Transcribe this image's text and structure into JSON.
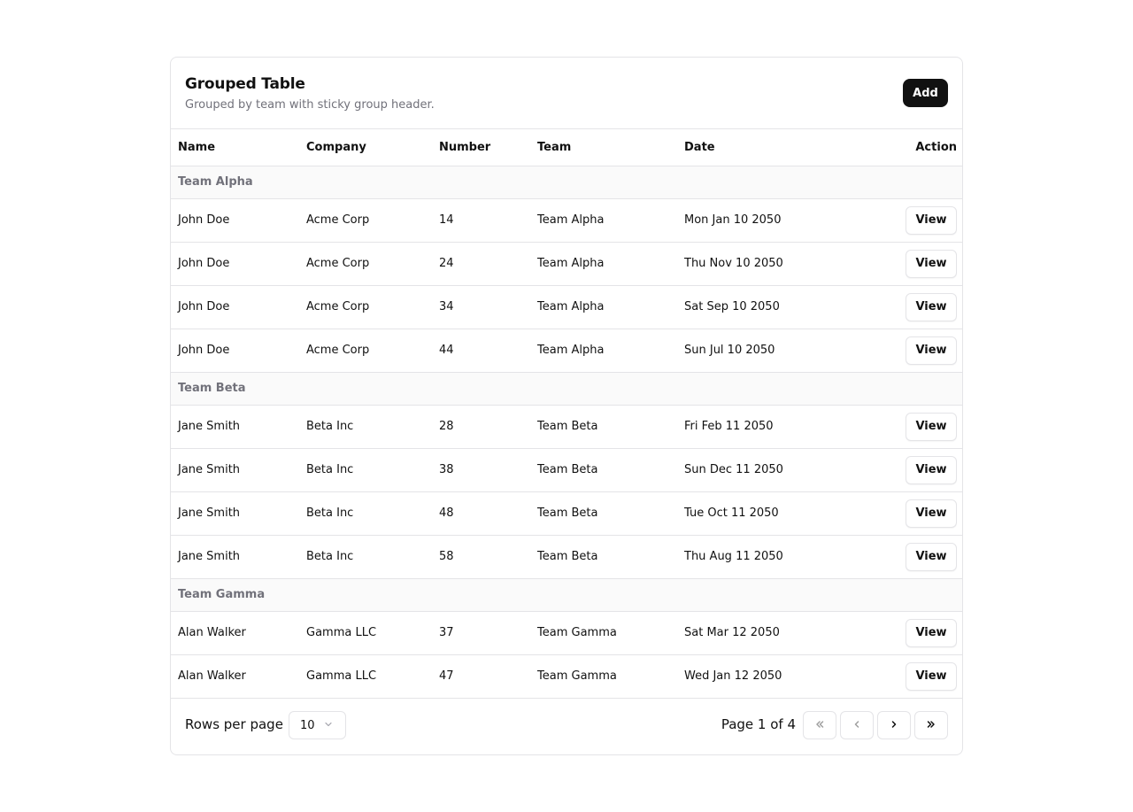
{
  "header": {
    "title": "Grouped Table",
    "subtitle": "Grouped by team with sticky group header.",
    "add_label": "Add"
  },
  "columns": [
    "Name",
    "Company",
    "Number",
    "Team",
    "Date",
    "Action"
  ],
  "groups": [
    {
      "name": "Team Alpha",
      "rows": [
        {
          "name": "John Doe",
          "company": "Acme Corp",
          "number": "14",
          "team": "Team Alpha",
          "date": "Mon Jan 10 2050",
          "action": "View"
        },
        {
          "name": "John Doe",
          "company": "Acme Corp",
          "number": "24",
          "team": "Team Alpha",
          "date": "Thu Nov 10 2050",
          "action": "View"
        },
        {
          "name": "John Doe",
          "company": "Acme Corp",
          "number": "34",
          "team": "Team Alpha",
          "date": "Sat Sep 10 2050",
          "action": "View"
        },
        {
          "name": "John Doe",
          "company": "Acme Corp",
          "number": "44",
          "team": "Team Alpha",
          "date": "Sun Jul 10 2050",
          "action": "View"
        }
      ]
    },
    {
      "name": "Team Beta",
      "rows": [
        {
          "name": "Jane Smith",
          "company": "Beta Inc",
          "number": "28",
          "team": "Team Beta",
          "date": "Fri Feb 11 2050",
          "action": "View"
        },
        {
          "name": "Jane Smith",
          "company": "Beta Inc",
          "number": "38",
          "team": "Team Beta",
          "date": "Sun Dec 11 2050",
          "action": "View"
        },
        {
          "name": "Jane Smith",
          "company": "Beta Inc",
          "number": "48",
          "team": "Team Beta",
          "date": "Tue Oct 11 2050",
          "action": "View"
        },
        {
          "name": "Jane Smith",
          "company": "Beta Inc",
          "number": "58",
          "team": "Team Beta",
          "date": "Thu Aug 11 2050",
          "action": "View"
        }
      ]
    },
    {
      "name": "Team Gamma",
      "rows": [
        {
          "name": "Alan Walker",
          "company": "Gamma LLC",
          "number": "37",
          "team": "Team Gamma",
          "date": "Sat Mar 12 2050",
          "action": "View"
        },
        {
          "name": "Alan Walker",
          "company": "Gamma LLC",
          "number": "47",
          "team": "Team Gamma",
          "date": "Wed Jan 12 2050",
          "action": "View"
        }
      ]
    }
  ],
  "footer": {
    "rows_per_page_label": "Rows per page",
    "rows_per_page_value": "10",
    "page_info": "Page 1 of 4",
    "icons": {
      "first": "chevrons-left-icon",
      "prev": "chevron-left-icon",
      "next": "chevron-right-icon",
      "last": "chevrons-right-icon",
      "select": "chevron-down-icon"
    }
  },
  "colors": {
    "primary_button": "#111111",
    "border": "#e4e4e7",
    "muted_text": "#71717a",
    "group_background": "#fafafa"
  }
}
